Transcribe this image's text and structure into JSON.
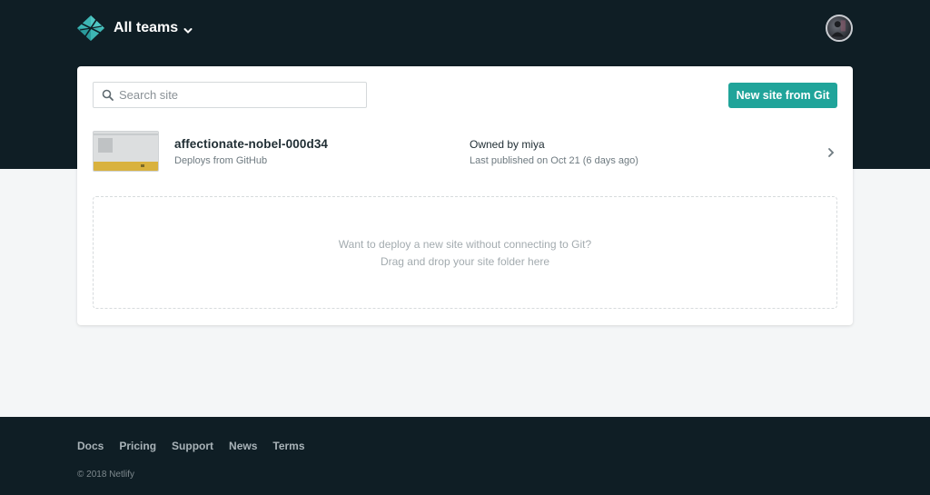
{
  "header": {
    "team_label": "All teams",
    "logo_icon": "netlify-logo-icon",
    "avatar_icon": "user-avatar",
    "band_color": "#0f1e25"
  },
  "search": {
    "placeholder": "Search site",
    "value": ""
  },
  "actions": {
    "new_site_label": "New site from Git",
    "accent_color": "#20a49a"
  },
  "sites": [
    {
      "name": "affectionate-nobel-000d34",
      "source": "Deploys from GitHub",
      "owner_prefix": "Owned by",
      "owner": "miya",
      "published": "Last published on Oct 21 (6 days ago)"
    }
  ],
  "dropzone": {
    "line1": "Want to deploy a new site without connecting to Git?",
    "line2": "Drag and drop your site folder here"
  },
  "footer": {
    "links": [
      "Docs",
      "Pricing",
      "Support",
      "News",
      "Terms"
    ],
    "copyright": "© 2018 Netlify"
  }
}
